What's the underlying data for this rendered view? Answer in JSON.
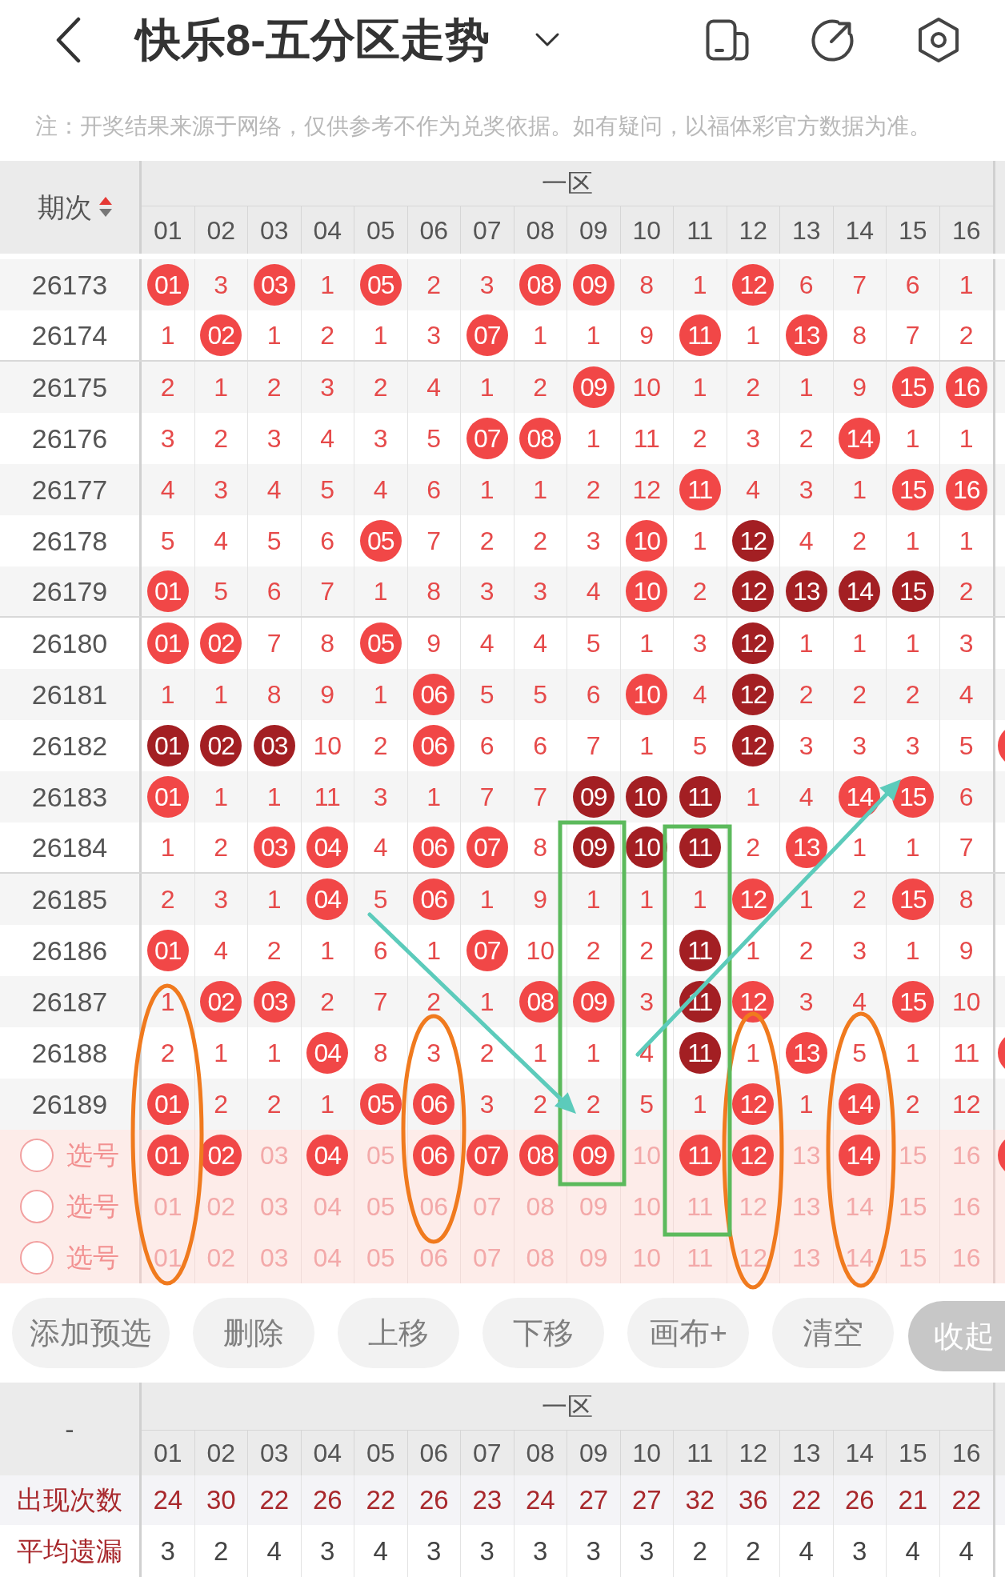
{
  "header": {
    "title": "快乐8-五分区走势"
  },
  "note": "注：开奖结果来源于网络，仅供参考不作为兑奖依据。如有疑问，以福体彩官方数据为准。",
  "trend_table": {
    "period_header": "期次",
    "ascending": true,
    "zone": "一区",
    "columns": [
      "01",
      "02",
      "03",
      "04",
      "05",
      "06",
      "07",
      "08",
      "09",
      "10",
      "11",
      "12",
      "13",
      "14",
      "15",
      "16"
    ],
    "rows": [
      {
        "period": "26173",
        "clipped_ball": false,
        "cells": [
          {
            "text": "01",
            "kind": "ball"
          },
          {
            "text": "3",
            "kind": "plain"
          },
          {
            "text": "03",
            "kind": "ball"
          },
          {
            "text": "1",
            "kind": "plain"
          },
          {
            "text": "05",
            "kind": "ball"
          },
          {
            "text": "2",
            "kind": "plain"
          },
          {
            "text": "3",
            "kind": "plain"
          },
          {
            "text": "08",
            "kind": "ball"
          },
          {
            "text": "09",
            "kind": "ball"
          },
          {
            "text": "8",
            "kind": "plain"
          },
          {
            "text": "1",
            "kind": "plain"
          },
          {
            "text": "12",
            "kind": "ball"
          },
          {
            "text": "6",
            "kind": "plain"
          },
          {
            "text": "7",
            "kind": "plain"
          },
          {
            "text": "6",
            "kind": "plain"
          },
          {
            "text": "1",
            "kind": "plain"
          }
        ]
      },
      {
        "period": "26174",
        "clipped_ball": false,
        "cells": [
          {
            "text": "1",
            "kind": "plain"
          },
          {
            "text": "02",
            "kind": "ball"
          },
          {
            "text": "1",
            "kind": "plain"
          },
          {
            "text": "2",
            "kind": "plain"
          },
          {
            "text": "1",
            "kind": "plain"
          },
          {
            "text": "3",
            "kind": "plain"
          },
          {
            "text": "07",
            "kind": "ball"
          },
          {
            "text": "1",
            "kind": "plain"
          },
          {
            "text": "1",
            "kind": "plain"
          },
          {
            "text": "9",
            "kind": "plain"
          },
          {
            "text": "11",
            "kind": "ball"
          },
          {
            "text": "1",
            "kind": "plain"
          },
          {
            "text": "13",
            "kind": "ball"
          },
          {
            "text": "8",
            "kind": "plain"
          },
          {
            "text": "7",
            "kind": "plain"
          },
          {
            "text": "2",
            "kind": "plain"
          }
        ]
      },
      {
        "period": "26175",
        "clipped_ball": false,
        "cells": [
          {
            "text": "2",
            "kind": "plain"
          },
          {
            "text": "1",
            "kind": "plain"
          },
          {
            "text": "2",
            "kind": "plain"
          },
          {
            "text": "3",
            "kind": "plain"
          },
          {
            "text": "2",
            "kind": "plain"
          },
          {
            "text": "4",
            "kind": "plain"
          },
          {
            "text": "1",
            "kind": "plain"
          },
          {
            "text": "2",
            "kind": "plain"
          },
          {
            "text": "09",
            "kind": "ball"
          },
          {
            "text": "10",
            "kind": "plain"
          },
          {
            "text": "1",
            "kind": "plain"
          },
          {
            "text": "2",
            "kind": "plain"
          },
          {
            "text": "1",
            "kind": "plain"
          },
          {
            "text": "9",
            "kind": "plain"
          },
          {
            "text": "15",
            "kind": "ball"
          },
          {
            "text": "16",
            "kind": "ball"
          }
        ]
      },
      {
        "period": "26176",
        "clipped_ball": false,
        "cells": [
          {
            "text": "3",
            "kind": "plain"
          },
          {
            "text": "2",
            "kind": "plain"
          },
          {
            "text": "3",
            "kind": "plain"
          },
          {
            "text": "4",
            "kind": "plain"
          },
          {
            "text": "3",
            "kind": "plain"
          },
          {
            "text": "5",
            "kind": "plain"
          },
          {
            "text": "07",
            "kind": "ball"
          },
          {
            "text": "08",
            "kind": "ball"
          },
          {
            "text": "1",
            "kind": "plain"
          },
          {
            "text": "11",
            "kind": "plain"
          },
          {
            "text": "2",
            "kind": "plain"
          },
          {
            "text": "3",
            "kind": "plain"
          },
          {
            "text": "2",
            "kind": "plain"
          },
          {
            "text": "14",
            "kind": "ball"
          },
          {
            "text": "1",
            "kind": "plain"
          },
          {
            "text": "1",
            "kind": "plain"
          }
        ]
      },
      {
        "period": "26177",
        "clipped_ball": false,
        "cells": [
          {
            "text": "4",
            "kind": "plain"
          },
          {
            "text": "3",
            "kind": "plain"
          },
          {
            "text": "4",
            "kind": "plain"
          },
          {
            "text": "5",
            "kind": "plain"
          },
          {
            "text": "4",
            "kind": "plain"
          },
          {
            "text": "6",
            "kind": "plain"
          },
          {
            "text": "1",
            "kind": "plain"
          },
          {
            "text": "1",
            "kind": "plain"
          },
          {
            "text": "2",
            "kind": "plain"
          },
          {
            "text": "12",
            "kind": "plain"
          },
          {
            "text": "11",
            "kind": "ball"
          },
          {
            "text": "4",
            "kind": "plain"
          },
          {
            "text": "3",
            "kind": "plain"
          },
          {
            "text": "1",
            "kind": "plain"
          },
          {
            "text": "15",
            "kind": "ball"
          },
          {
            "text": "16",
            "kind": "ball"
          }
        ]
      },
      {
        "period": "26178",
        "clipped_ball": false,
        "cells": [
          {
            "text": "5",
            "kind": "plain"
          },
          {
            "text": "4",
            "kind": "plain"
          },
          {
            "text": "5",
            "kind": "plain"
          },
          {
            "text": "6",
            "kind": "plain"
          },
          {
            "text": "05",
            "kind": "ball"
          },
          {
            "text": "7",
            "kind": "plain"
          },
          {
            "text": "2",
            "kind": "plain"
          },
          {
            "text": "2",
            "kind": "plain"
          },
          {
            "text": "3",
            "kind": "plain"
          },
          {
            "text": "10",
            "kind": "ball"
          },
          {
            "text": "1",
            "kind": "plain"
          },
          {
            "text": "12",
            "kind": "dark"
          },
          {
            "text": "4",
            "kind": "plain"
          },
          {
            "text": "2",
            "kind": "plain"
          },
          {
            "text": "1",
            "kind": "plain"
          },
          {
            "text": "1",
            "kind": "plain"
          }
        ]
      },
      {
        "period": "26179",
        "clipped_ball": false,
        "cells": [
          {
            "text": "01",
            "kind": "ball"
          },
          {
            "text": "5",
            "kind": "plain"
          },
          {
            "text": "6",
            "kind": "plain"
          },
          {
            "text": "7",
            "kind": "plain"
          },
          {
            "text": "1",
            "kind": "plain"
          },
          {
            "text": "8",
            "kind": "plain"
          },
          {
            "text": "3",
            "kind": "plain"
          },
          {
            "text": "3",
            "kind": "plain"
          },
          {
            "text": "4",
            "kind": "plain"
          },
          {
            "text": "10",
            "kind": "ball"
          },
          {
            "text": "2",
            "kind": "plain"
          },
          {
            "text": "12",
            "kind": "dark"
          },
          {
            "text": "13",
            "kind": "dark"
          },
          {
            "text": "14",
            "kind": "dark"
          },
          {
            "text": "15",
            "kind": "dark"
          },
          {
            "text": "2",
            "kind": "plain"
          }
        ]
      },
      {
        "period": "26180",
        "clipped_ball": false,
        "cells": [
          {
            "text": "01",
            "kind": "ball"
          },
          {
            "text": "02",
            "kind": "ball"
          },
          {
            "text": "7",
            "kind": "plain"
          },
          {
            "text": "8",
            "kind": "plain"
          },
          {
            "text": "05",
            "kind": "ball"
          },
          {
            "text": "9",
            "kind": "plain"
          },
          {
            "text": "4",
            "kind": "plain"
          },
          {
            "text": "4",
            "kind": "plain"
          },
          {
            "text": "5",
            "kind": "plain"
          },
          {
            "text": "1",
            "kind": "plain"
          },
          {
            "text": "3",
            "kind": "plain"
          },
          {
            "text": "12",
            "kind": "dark"
          },
          {
            "text": "1",
            "kind": "plain"
          },
          {
            "text": "1",
            "kind": "plain"
          },
          {
            "text": "1",
            "kind": "plain"
          },
          {
            "text": "3",
            "kind": "plain"
          }
        ]
      },
      {
        "period": "26181",
        "clipped_ball": false,
        "cells": [
          {
            "text": "1",
            "kind": "plain"
          },
          {
            "text": "1",
            "kind": "plain"
          },
          {
            "text": "8",
            "kind": "plain"
          },
          {
            "text": "9",
            "kind": "plain"
          },
          {
            "text": "1",
            "kind": "plain"
          },
          {
            "text": "06",
            "kind": "ball"
          },
          {
            "text": "5",
            "kind": "plain"
          },
          {
            "text": "5",
            "kind": "plain"
          },
          {
            "text": "6",
            "kind": "plain"
          },
          {
            "text": "10",
            "kind": "ball"
          },
          {
            "text": "4",
            "kind": "plain"
          },
          {
            "text": "12",
            "kind": "dark"
          },
          {
            "text": "2",
            "kind": "plain"
          },
          {
            "text": "2",
            "kind": "plain"
          },
          {
            "text": "2",
            "kind": "plain"
          },
          {
            "text": "4",
            "kind": "plain"
          }
        ]
      },
      {
        "period": "26182",
        "clipped_ball": true,
        "cells": [
          {
            "text": "01",
            "kind": "dark"
          },
          {
            "text": "02",
            "kind": "dark"
          },
          {
            "text": "03",
            "kind": "dark"
          },
          {
            "text": "10",
            "kind": "plain"
          },
          {
            "text": "2",
            "kind": "plain"
          },
          {
            "text": "06",
            "kind": "ball"
          },
          {
            "text": "6",
            "kind": "plain"
          },
          {
            "text": "6",
            "kind": "plain"
          },
          {
            "text": "7",
            "kind": "plain"
          },
          {
            "text": "1",
            "kind": "plain"
          },
          {
            "text": "5",
            "kind": "plain"
          },
          {
            "text": "12",
            "kind": "dark"
          },
          {
            "text": "3",
            "kind": "plain"
          },
          {
            "text": "3",
            "kind": "plain"
          },
          {
            "text": "3",
            "kind": "plain"
          },
          {
            "text": "5",
            "kind": "plain"
          }
        ]
      },
      {
        "period": "26183",
        "clipped_ball": false,
        "cells": [
          {
            "text": "01",
            "kind": "ball"
          },
          {
            "text": "1",
            "kind": "plain"
          },
          {
            "text": "1",
            "kind": "plain"
          },
          {
            "text": "11",
            "kind": "plain"
          },
          {
            "text": "3",
            "kind": "plain"
          },
          {
            "text": "1",
            "kind": "plain"
          },
          {
            "text": "7",
            "kind": "plain"
          },
          {
            "text": "7",
            "kind": "plain"
          },
          {
            "text": "09",
            "kind": "dark"
          },
          {
            "text": "10",
            "kind": "dark"
          },
          {
            "text": "11",
            "kind": "dark"
          },
          {
            "text": "1",
            "kind": "plain"
          },
          {
            "text": "4",
            "kind": "plain"
          },
          {
            "text": "14",
            "kind": "ball"
          },
          {
            "text": "15",
            "kind": "ball"
          },
          {
            "text": "6",
            "kind": "plain"
          }
        ]
      },
      {
        "period": "26184",
        "clipped_ball": false,
        "cells": [
          {
            "text": "1",
            "kind": "plain"
          },
          {
            "text": "2",
            "kind": "plain"
          },
          {
            "text": "03",
            "kind": "ball"
          },
          {
            "text": "04",
            "kind": "ball"
          },
          {
            "text": "4",
            "kind": "plain"
          },
          {
            "text": "06",
            "kind": "ball"
          },
          {
            "text": "07",
            "kind": "ball"
          },
          {
            "text": "8",
            "kind": "plain"
          },
          {
            "text": "09",
            "kind": "dark"
          },
          {
            "text": "10",
            "kind": "dark"
          },
          {
            "text": "11",
            "kind": "dark"
          },
          {
            "text": "2",
            "kind": "plain"
          },
          {
            "text": "13",
            "kind": "ball"
          },
          {
            "text": "1",
            "kind": "plain"
          },
          {
            "text": "1",
            "kind": "plain"
          },
          {
            "text": "7",
            "kind": "plain"
          }
        ]
      },
      {
        "period": "26185",
        "clipped_ball": false,
        "cells": [
          {
            "text": "2",
            "kind": "plain"
          },
          {
            "text": "3",
            "kind": "plain"
          },
          {
            "text": "1",
            "kind": "plain"
          },
          {
            "text": "04",
            "kind": "ball"
          },
          {
            "text": "5",
            "kind": "plain"
          },
          {
            "text": "06",
            "kind": "ball"
          },
          {
            "text": "1",
            "kind": "plain"
          },
          {
            "text": "9",
            "kind": "plain"
          },
          {
            "text": "1",
            "kind": "plain"
          },
          {
            "text": "1",
            "kind": "plain"
          },
          {
            "text": "1",
            "kind": "plain"
          },
          {
            "text": "12",
            "kind": "ball"
          },
          {
            "text": "1",
            "kind": "plain"
          },
          {
            "text": "2",
            "kind": "plain"
          },
          {
            "text": "15",
            "kind": "ball"
          },
          {
            "text": "8",
            "kind": "plain"
          }
        ]
      },
      {
        "period": "26186",
        "clipped_ball": false,
        "cells": [
          {
            "text": "01",
            "kind": "ball"
          },
          {
            "text": "4",
            "kind": "plain"
          },
          {
            "text": "2",
            "kind": "plain"
          },
          {
            "text": "1",
            "kind": "plain"
          },
          {
            "text": "6",
            "kind": "plain"
          },
          {
            "text": "1",
            "kind": "plain"
          },
          {
            "text": "07",
            "kind": "ball"
          },
          {
            "text": "10",
            "kind": "plain"
          },
          {
            "text": "2",
            "kind": "plain"
          },
          {
            "text": "2",
            "kind": "plain"
          },
          {
            "text": "11",
            "kind": "dark"
          },
          {
            "text": "1",
            "kind": "plain"
          },
          {
            "text": "2",
            "kind": "plain"
          },
          {
            "text": "3",
            "kind": "plain"
          },
          {
            "text": "1",
            "kind": "plain"
          },
          {
            "text": "9",
            "kind": "plain"
          }
        ]
      },
      {
        "period": "26187",
        "clipped_ball": false,
        "cells": [
          {
            "text": "1",
            "kind": "plain"
          },
          {
            "text": "02",
            "kind": "ball"
          },
          {
            "text": "03",
            "kind": "ball"
          },
          {
            "text": "2",
            "kind": "plain"
          },
          {
            "text": "7",
            "kind": "plain"
          },
          {
            "text": "2",
            "kind": "plain"
          },
          {
            "text": "1",
            "kind": "plain"
          },
          {
            "text": "08",
            "kind": "ball"
          },
          {
            "text": "09",
            "kind": "ball"
          },
          {
            "text": "3",
            "kind": "plain"
          },
          {
            "text": "11",
            "kind": "dark"
          },
          {
            "text": "12",
            "kind": "ball"
          },
          {
            "text": "3",
            "kind": "plain"
          },
          {
            "text": "4",
            "kind": "plain"
          },
          {
            "text": "15",
            "kind": "ball"
          },
          {
            "text": "10",
            "kind": "plain"
          }
        ]
      },
      {
        "period": "26188",
        "clipped_ball": true,
        "cells": [
          {
            "text": "2",
            "kind": "plain"
          },
          {
            "text": "1",
            "kind": "plain"
          },
          {
            "text": "1",
            "kind": "plain"
          },
          {
            "text": "04",
            "kind": "ball"
          },
          {
            "text": "8",
            "kind": "plain"
          },
          {
            "text": "3",
            "kind": "plain"
          },
          {
            "text": "2",
            "kind": "plain"
          },
          {
            "text": "1",
            "kind": "plain"
          },
          {
            "text": "1",
            "kind": "plain"
          },
          {
            "text": "4",
            "kind": "plain"
          },
          {
            "text": "11",
            "kind": "dark"
          },
          {
            "text": "1",
            "kind": "plain"
          },
          {
            "text": "13",
            "kind": "ball"
          },
          {
            "text": "5",
            "kind": "plain"
          },
          {
            "text": "1",
            "kind": "plain"
          },
          {
            "text": "11",
            "kind": "plain"
          }
        ]
      },
      {
        "period": "26189",
        "clipped_ball": false,
        "cells": [
          {
            "text": "01",
            "kind": "ball"
          },
          {
            "text": "2",
            "kind": "plain"
          },
          {
            "text": "2",
            "kind": "plain"
          },
          {
            "text": "1",
            "kind": "plain"
          },
          {
            "text": "05",
            "kind": "ball"
          },
          {
            "text": "06",
            "kind": "ball"
          },
          {
            "text": "3",
            "kind": "plain"
          },
          {
            "text": "2",
            "kind": "plain"
          },
          {
            "text": "2",
            "kind": "plain"
          },
          {
            "text": "5",
            "kind": "plain"
          },
          {
            "text": "1",
            "kind": "plain"
          },
          {
            "text": "12",
            "kind": "ball"
          },
          {
            "text": "1",
            "kind": "plain"
          },
          {
            "text": "14",
            "kind": "ball"
          },
          {
            "text": "2",
            "kind": "plain"
          },
          {
            "text": "12",
            "kind": "plain"
          }
        ]
      }
    ],
    "pick_rows": [
      {
        "label": "选号",
        "checked": false,
        "clipped_ball": true,
        "numbers": [
          {
            "text": "01",
            "selected": true
          },
          {
            "text": "02",
            "selected": true
          },
          {
            "text": "03",
            "selected": false
          },
          {
            "text": "04",
            "selected": true
          },
          {
            "text": "05",
            "selected": false
          },
          {
            "text": "06",
            "selected": true
          },
          {
            "text": "07",
            "selected": true
          },
          {
            "text": "08",
            "selected": true
          },
          {
            "text": "09",
            "selected": true
          },
          {
            "text": "10",
            "selected": false
          },
          {
            "text": "11",
            "selected": true
          },
          {
            "text": "12",
            "selected": true
          },
          {
            "text": "13",
            "selected": false
          },
          {
            "text": "14",
            "selected": true
          },
          {
            "text": "15",
            "selected": false
          },
          {
            "text": "16",
            "selected": false
          }
        ]
      },
      {
        "label": "选号",
        "checked": false,
        "clipped_ball": false,
        "numbers": [
          {
            "text": "01",
            "selected": false
          },
          {
            "text": "02",
            "selected": false
          },
          {
            "text": "03",
            "selected": false
          },
          {
            "text": "04",
            "selected": false
          },
          {
            "text": "05",
            "selected": false
          },
          {
            "text": "06",
            "selected": false
          },
          {
            "text": "07",
            "selected": false
          },
          {
            "text": "08",
            "selected": false
          },
          {
            "text": "09",
            "selected": false
          },
          {
            "text": "10",
            "selected": false
          },
          {
            "text": "11",
            "selected": false
          },
          {
            "text": "12",
            "selected": false
          },
          {
            "text": "13",
            "selected": false
          },
          {
            "text": "14",
            "selected": false
          },
          {
            "text": "15",
            "selected": false
          },
          {
            "text": "16",
            "selected": false
          }
        ]
      },
      {
        "label": "选号",
        "checked": false,
        "clipped_ball": false,
        "numbers": [
          {
            "text": "01",
            "selected": false
          },
          {
            "text": "02",
            "selected": false
          },
          {
            "text": "03",
            "selected": false
          },
          {
            "text": "04",
            "selected": false
          },
          {
            "text": "05",
            "selected": false
          },
          {
            "text": "06",
            "selected": false
          },
          {
            "text": "07",
            "selected": false
          },
          {
            "text": "08",
            "selected": false
          },
          {
            "text": "09",
            "selected": false
          },
          {
            "text": "10",
            "selected": false
          },
          {
            "text": "11",
            "selected": false
          },
          {
            "text": "12",
            "selected": false
          },
          {
            "text": "13",
            "selected": false
          },
          {
            "text": "14",
            "selected": false
          },
          {
            "text": "15",
            "selected": false
          },
          {
            "text": "16",
            "selected": false
          }
        ]
      }
    ]
  },
  "annotations": [
    {
      "kind": "ellipse",
      "color": "#f07a1e"
    },
    {
      "kind": "ellipse",
      "color": "#f07a1e"
    },
    {
      "kind": "ellipse",
      "color": "#f07a1e"
    },
    {
      "kind": "ellipse",
      "color": "#f07a1e"
    },
    {
      "kind": "frame",
      "color": "#5cba5c"
    },
    {
      "kind": "frame",
      "color": "#5cba5c"
    },
    {
      "kind": "arrow",
      "color": "#5ccbbb"
    },
    {
      "kind": "arrow",
      "color": "#5ccbbb"
    }
  ],
  "buttons": [
    {
      "label": "添加预选",
      "kind": "normal"
    },
    {
      "label": "删除",
      "kind": "normal"
    },
    {
      "label": "上移",
      "kind": "normal"
    },
    {
      "label": "下移",
      "kind": "normal"
    },
    {
      "label": "画布+",
      "kind": "normal"
    },
    {
      "label": "清空",
      "kind": "normal"
    },
    {
      "label": "收起",
      "kind": "collapse"
    }
  ],
  "stats_table": {
    "corner": "-",
    "zone": "一区",
    "columns": [
      "01",
      "02",
      "03",
      "04",
      "05",
      "06",
      "07",
      "08",
      "09",
      "10",
      "11",
      "12",
      "13",
      "14",
      "15",
      "16"
    ],
    "rows": [
      {
        "label": "出现次数",
        "kind": "count",
        "values": [
          "24",
          "30",
          "22",
          "26",
          "22",
          "26",
          "23",
          "24",
          "27",
          "27",
          "32",
          "36",
          "22",
          "26",
          "21",
          "22"
        ]
      },
      {
        "label": "平均遗漏",
        "kind": "average",
        "values": [
          "3",
          "2",
          "4",
          "3",
          "4",
          "3",
          "3",
          "3",
          "3",
          "3",
          "2",
          "2",
          "4",
          "3",
          "4",
          "4"
        ]
      }
    ]
  }
}
